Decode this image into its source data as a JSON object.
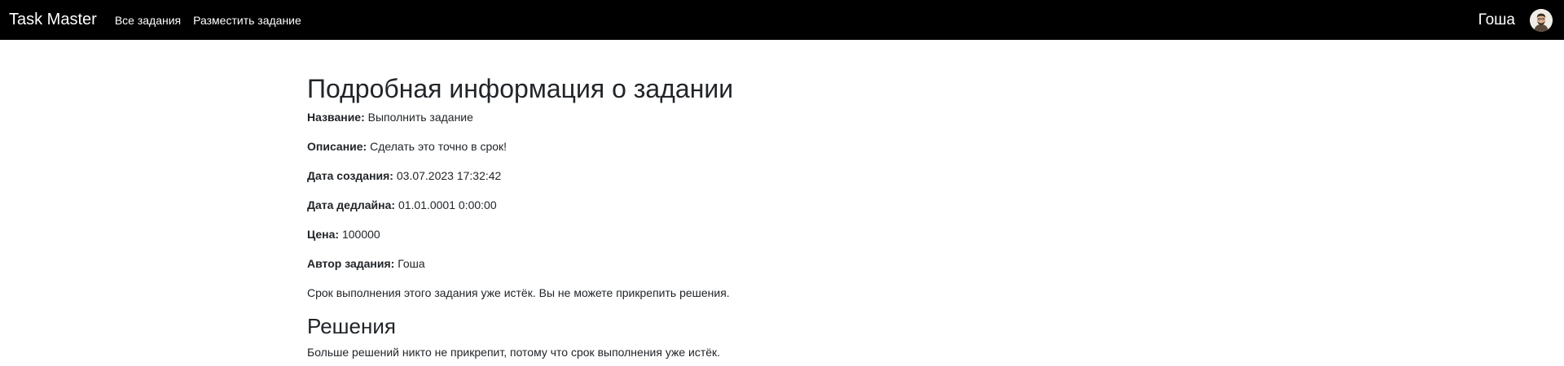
{
  "navbar": {
    "brand": "Task Master",
    "links": [
      "Все задания",
      "Разместить задание"
    ],
    "username": "Гоша"
  },
  "task": {
    "page_title": "Подробная информация о задании",
    "fields": [
      {
        "label": "Название:",
        "value": "Выполнить задание"
      },
      {
        "label": "Описание:",
        "value": "Сделать это точно в срок!"
      },
      {
        "label": "Дата создания:",
        "value": "03.07.2023 17:32:42"
      },
      {
        "label": "Дата дедлайна:",
        "value": "01.01.0001 0:00:00"
      },
      {
        "label": "Цена:",
        "value": "100000"
      },
      {
        "label": "Автор задания:",
        "value": "Гоша"
      }
    ],
    "expired_notice": "Срок выполнения этого задания уже истёк. Вы не можете прикрепить решения."
  },
  "solutions": {
    "heading": "Решения",
    "notice": "Больше решений никто не прикрепит, потому что срок выполнения уже истёк."
  }
}
